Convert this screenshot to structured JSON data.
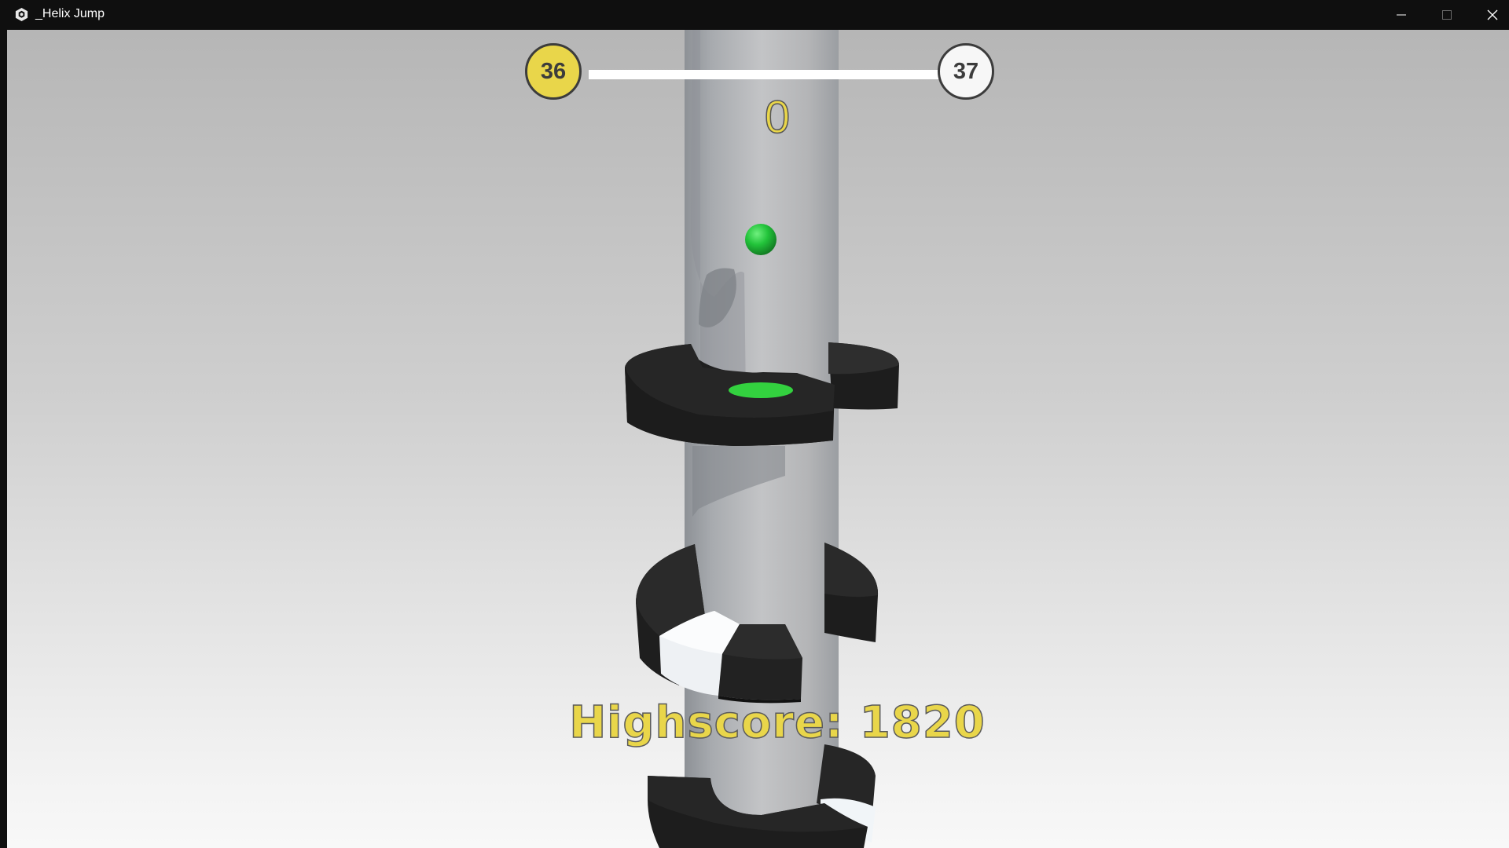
{
  "window": {
    "title": "_Helix Jump",
    "app_icon": "unity-icon",
    "controls": [
      "minimize-icon",
      "maximize-icon",
      "close-icon"
    ]
  },
  "hud": {
    "current_level": "36",
    "next_level": "37",
    "level_progress": 0,
    "score": "0",
    "highscore": "Highscore: 1820"
  },
  "colors": {
    "accent_yellow": "#e9d64a",
    "ball_green": "#22c33a",
    "platform_dark": "#232323",
    "danger_white": "#f0f3f7",
    "pillar_gray": "#b8b9bb"
  }
}
